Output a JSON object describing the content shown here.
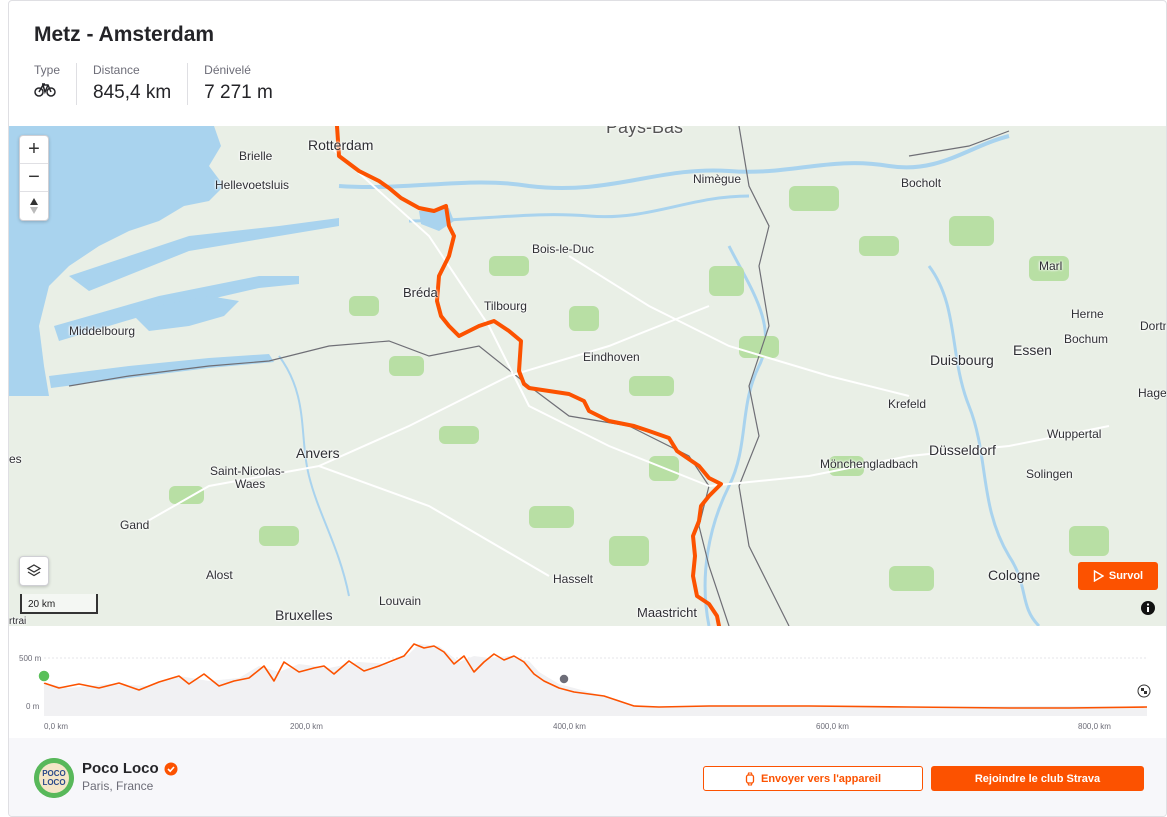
{
  "route": {
    "title": "Metz - Amsterdam",
    "stats": {
      "type_label": "Type",
      "distance_label": "Distance",
      "distance_value": "845,4 km",
      "elevation_label": "Dénivelé",
      "elevation_value": "7 271 m"
    }
  },
  "map": {
    "zoom_in": "+",
    "zoom_out": "−",
    "scale_label": "20 km",
    "survol_label": "Survol",
    "country_label": "Pays-Bas",
    "cities": [
      {
        "name": "Rotterdam",
        "big": true
      },
      {
        "name": "Brielle"
      },
      {
        "name": "Hellevoetsluis"
      },
      {
        "name": "Nimègue"
      },
      {
        "name": "Bocholt"
      },
      {
        "name": "Bois-le-Duc"
      },
      {
        "name": "Marl"
      },
      {
        "name": "Bréda",
        "big": true
      },
      {
        "name": "Tilbourg"
      },
      {
        "name": "Herne"
      },
      {
        "name": "Dortmu"
      },
      {
        "name": "Bochum"
      },
      {
        "name": "Middelbourg"
      },
      {
        "name": "Essen",
        "big": true
      },
      {
        "name": "Eindhoven"
      },
      {
        "name": "Duisbourg",
        "big": true
      },
      {
        "name": "Hage"
      },
      {
        "name": "Krefeld"
      },
      {
        "name": "Wuppertal"
      },
      {
        "name": "Anvers",
        "big": true
      },
      {
        "name": "Düsseldorf",
        "big": true
      },
      {
        "name": "es"
      },
      {
        "name": "Mönchengladbach"
      },
      {
        "name": "Saint-Nicolas-"
      },
      {
        "name": "Waes"
      },
      {
        "name": "Solingen"
      },
      {
        "name": "Gand"
      },
      {
        "name": "Alost"
      },
      {
        "name": "Hasselt"
      },
      {
        "name": "Cologne",
        "big": true
      },
      {
        "name": "Bruxelles",
        "big": true
      },
      {
        "name": "Louvain"
      },
      {
        "name": "Maastricht",
        "big": true
      },
      {
        "name": "rtrai"
      }
    ]
  },
  "elevation_profile": {
    "y_labels": [
      "500 m",
      "0 m"
    ],
    "x_labels": [
      "0,0 km",
      "200,0 km",
      "400,0 km",
      "600,0 km",
      "800,0 km"
    ]
  },
  "club": {
    "name": "Poco Loco",
    "location": "Paris, France",
    "avatar_text_1": "POCO",
    "avatar_text_2": "LOCO",
    "send_button": "Envoyer vers l'appareil",
    "join_button": "Rejoindre le club Strava"
  },
  "colors": {
    "accent": "#fc5200",
    "water": "#a9d3ee",
    "land": "#e9efe6",
    "forest": "#9fd18a"
  }
}
